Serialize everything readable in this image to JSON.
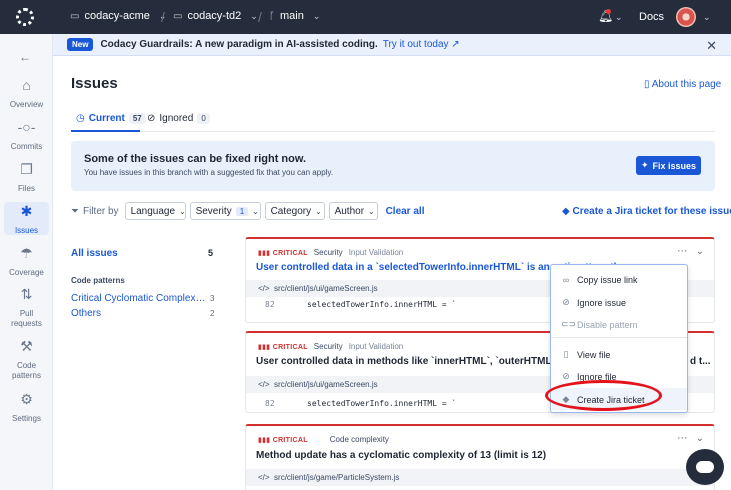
{
  "topbar": {
    "org": "codacy-acme",
    "repo": "codacy-td2",
    "branch": "main",
    "docs": "Docs"
  },
  "sidebar": {
    "items": [
      {
        "label": "Overview",
        "icon": "home-icon"
      },
      {
        "label": "Commits",
        "icon": "commit-icon"
      },
      {
        "label": "Files",
        "icon": "files-icon"
      },
      {
        "label": "Issues",
        "icon": "bug-icon"
      },
      {
        "label": "Coverage",
        "icon": "umbrella-icon"
      },
      {
        "label": "Pull requests",
        "icon": "pull-request-icon"
      },
      {
        "label": "Code patterns",
        "icon": "tools-icon"
      },
      {
        "label": "Settings",
        "icon": "gear-icon"
      }
    ]
  },
  "banner": {
    "badge": "New",
    "text": "Codacy Guardrails: A new paradigm in AI-assisted coding.",
    "link": "Try it out today"
  },
  "page": {
    "title": "Issues",
    "about": "About this page"
  },
  "tabs": [
    {
      "label": "Current",
      "count": "57"
    },
    {
      "label": "Ignored",
      "count": "0"
    }
  ],
  "fix": {
    "title": "Some of the issues can be fixed right now.",
    "subtitle": "You have issues in this branch with a suggested fix that you can apply.",
    "button": "Fix issues"
  },
  "filters": {
    "label": "Filter by",
    "language": "Language",
    "severity": "Severity",
    "severity_count": "1",
    "category": "Category",
    "author": "Author",
    "clear": "Clear all",
    "jira": "Create a Jira ticket for these issues"
  },
  "categories": {
    "all_label": "All issues",
    "all_count": "5",
    "heading": "Code patterns",
    "items": [
      {
        "label": "Critical Cyclomatic Complexity co...",
        "count": "3"
      },
      {
        "label": "Others",
        "count": "2"
      }
    ]
  },
  "issues": [
    {
      "severity": "CRITICAL",
      "category": "Security",
      "subcategory": "Input Validation",
      "title": "User controlled data in a `selectedTowerInfo.innerHTML` is an anti-pattern tha",
      "file": "src/client/js/ui/gameScreen.js",
      "line": "82",
      "code": "selectedTowerInfo.innerHTML = `"
    },
    {
      "severity": "CRITICAL",
      "category": "Security",
      "subcategory": "Input Validation",
      "title": "User controlled data in methods like `innerHTML`, `outerHTML` or `document",
      "title_tail": "d t...",
      "file": "src/client/js/ui/gameScreen.js",
      "line": "82",
      "code": "selectedTowerInfo.innerHTML = `"
    },
    {
      "severity": "CRITICAL",
      "category": "Code complexity",
      "subcategory": "",
      "title": "Method update has a cyclomatic complexity of 13 (limit is 12)",
      "file": "src/client/js/game/ParticleSystem.js"
    }
  ],
  "menu": {
    "items": [
      {
        "label": "Copy issue link",
        "icon": "link-icon",
        "disabled": false
      },
      {
        "label": "Ignore issue",
        "icon": "ban-icon",
        "disabled": false
      },
      {
        "label": "Disable pattern",
        "icon": "toggle-icon",
        "disabled": true
      },
      {
        "label": "View file",
        "icon": "file-icon",
        "disabled": false
      },
      {
        "label": "Ignore file",
        "icon": "ban-icon",
        "disabled": false
      },
      {
        "label": "Create Jira ticket",
        "icon": "tag-icon",
        "disabled": false
      }
    ]
  },
  "colors": {
    "accent": "#1a57d6",
    "topbar": "#252d3d",
    "critical": "#d32f2f",
    "annotation": "#e3131b"
  }
}
